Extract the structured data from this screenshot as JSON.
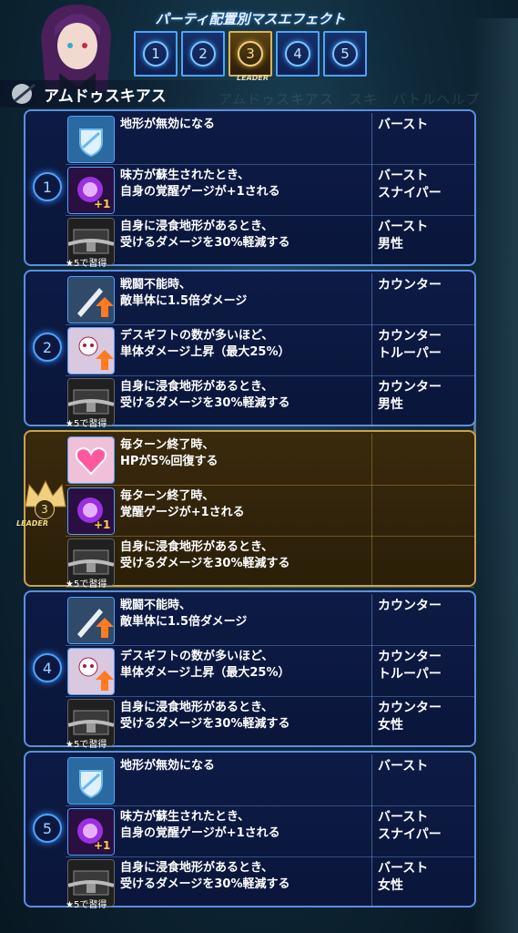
{
  "header": {
    "title": "パーティ配置別マスエフェクト",
    "tabs": [
      "1",
      "2",
      "3",
      "4",
      "5"
    ],
    "active_tab": 2,
    "leader_label": "LEADER"
  },
  "character": {
    "name": "アムドゥスキアス"
  },
  "background_ghost_text": "アムドゥスキアス　スキ　バトルヘルプ",
  "groups": [
    {
      "number": "1",
      "leader": false,
      "rows": [
        {
          "icon": "terrain-shield-icon",
          "desc": "地形が無効になる",
          "tag": "バースト"
        },
        {
          "icon": "awaken-orb-plus1-icon",
          "desc": "味方が蘇生されたとき、\n自身の覚醒ゲージが+1される",
          "tag": "バースト\nスナイパー"
        },
        {
          "icon": "chain-lock-icon",
          "desc": "自身に浸食地形があるとき、\n受けるダメージを30%軽減する",
          "tag": "バースト\n男性",
          "acquire": "★5で習得"
        }
      ]
    },
    {
      "number": "2",
      "leader": false,
      "rows": [
        {
          "icon": "sword-up-icon",
          "desc": "戦闘不能時、\n敵単体に1.5倍ダメージ",
          "tag": "カウンター"
        },
        {
          "icon": "skull-gift-up-icon",
          "desc": "デスギフトの数が多いほど、\n単体ダメージ上昇（最大25%）",
          "tag": "カウンター\nトルーパー"
        },
        {
          "icon": "chain-lock-icon",
          "desc": "自身に浸食地形があるとき、\n受けるダメージを30%軽減する",
          "tag": "カウンター\n男性",
          "acquire": "★5で習得"
        }
      ]
    },
    {
      "number": "3",
      "leader": true,
      "leader_label": "LEADER",
      "rows": [
        {
          "icon": "heart-heal-icon",
          "desc": "毎ターン終了時、\nHPが5%回復する",
          "tag": ""
        },
        {
          "icon": "awaken-orb-plus1-icon",
          "desc": "毎ターン終了時、\n覚醒ゲージが+1される",
          "tag": ""
        },
        {
          "icon": "chain-lock-icon",
          "desc": "自身に浸食地形があるとき、\n受けるダメージを30%軽減する",
          "tag": "",
          "acquire": "★5で習得"
        }
      ]
    },
    {
      "number": "4",
      "leader": false,
      "rows": [
        {
          "icon": "sword-up-icon",
          "desc": "戦闘不能時、\n敵単体に1.5倍ダメージ",
          "tag": "カウンター"
        },
        {
          "icon": "skull-gift-up-icon",
          "desc": "デスギフトの数が多いほど、\n単体ダメージ上昇（最大25%）",
          "tag": "カウンター\nトルーパー"
        },
        {
          "icon": "chain-lock-icon",
          "desc": "自身に浸食地形があるとき、\n受けるダメージを30%軽減する",
          "tag": "カウンター\n女性",
          "acquire": "★5で習得"
        }
      ]
    },
    {
      "number": "5",
      "leader": false,
      "rows": [
        {
          "icon": "terrain-shield-icon",
          "desc": "地形が無効になる",
          "tag": "バースト"
        },
        {
          "icon": "awaken-orb-plus1-icon",
          "desc": "味方が蘇生されたとき、\n自身の覚醒ゲージが+1される",
          "tag": "バースト\nスナイパー"
        },
        {
          "icon": "chain-lock-icon",
          "desc": "自身に浸食地形があるとき、\n受けるダメージを30%軽減する",
          "tag": "バースト\n女性",
          "acquire": "★5で習得"
        }
      ]
    }
  ]
}
